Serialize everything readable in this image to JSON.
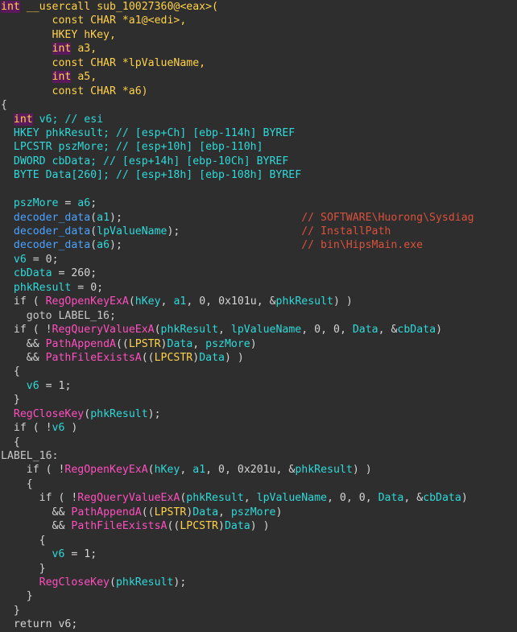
{
  "app": {
    "name": "ida-pseudocode-view",
    "theme": "dark"
  },
  "colors": {
    "background": "#2e2e2e",
    "default_text": "#d4d4d4",
    "keyword": "#ffd24a",
    "keyword_highlight_bg": "#5c1a5c",
    "api_function": "#ff4fbf",
    "user_function": "#4aa3ff",
    "variable": "#2fd9d9",
    "comment_local": "#2fd9d9",
    "comment_repeatable": "#d9513c",
    "number": "#d4d4d4",
    "label": "#c8c8c8"
  },
  "code": {
    "function_name": "sub_10027360",
    "lines": [
      [
        {
          "t": "int",
          "c": "t-kw-hl"
        },
        {
          "t": " ",
          "c": "t-plain"
        },
        {
          "t": "__usercall sub_10027360@<eax>(",
          "c": "t-fn"
        }
      ],
      [
        {
          "t": "        ",
          "c": "t-plain"
        },
        {
          "t": "const CHAR *a1@<edi>,",
          "c": "t-type"
        }
      ],
      [
        {
          "t": "        ",
          "c": "t-plain"
        },
        {
          "t": "HKEY hKey,",
          "c": "t-type"
        }
      ],
      [
        {
          "t": "        ",
          "c": "t-plain"
        },
        {
          "t": "int",
          "c": "t-kw-hl"
        },
        {
          "t": " ",
          "c": "t-plain"
        },
        {
          "t": "a3,",
          "c": "t-type"
        }
      ],
      [
        {
          "t": "        ",
          "c": "t-plain"
        },
        {
          "t": "const CHAR *lpValueName,",
          "c": "t-type"
        }
      ],
      [
        {
          "t": "        ",
          "c": "t-plain"
        },
        {
          "t": "int",
          "c": "t-kw-hl"
        },
        {
          "t": " ",
          "c": "t-plain"
        },
        {
          "t": "a5,",
          "c": "t-type"
        }
      ],
      [
        {
          "t": "        ",
          "c": "t-plain"
        },
        {
          "t": "const CHAR *a6)",
          "c": "t-type"
        }
      ],
      [
        {
          "t": "{",
          "c": "t-punct"
        }
      ],
      [
        {
          "t": "  ",
          "c": "t-plain"
        },
        {
          "t": "int",
          "c": "t-kw-hl"
        },
        {
          "t": " ",
          "c": "t-plain"
        },
        {
          "t": "v6;",
          "c": "t-var"
        },
        {
          "t": " ",
          "c": "t-plain"
        },
        {
          "t": "// esi",
          "c": "t-cmt"
        }
      ],
      [
        {
          "t": "  ",
          "c": "t-plain"
        },
        {
          "t": "HKEY phkResult;",
          "c": "t-var"
        },
        {
          "t": " ",
          "c": "t-plain"
        },
        {
          "t": "// [esp+Ch] [ebp-114h] BYREF",
          "c": "t-cmt"
        }
      ],
      [
        {
          "t": "  ",
          "c": "t-plain"
        },
        {
          "t": "LPCSTR pszMore;",
          "c": "t-var"
        },
        {
          "t": " ",
          "c": "t-plain"
        },
        {
          "t": "// [esp+10h] [ebp-110h]",
          "c": "t-cmt"
        }
      ],
      [
        {
          "t": "  ",
          "c": "t-plain"
        },
        {
          "t": "DWORD cbData;",
          "c": "t-var"
        },
        {
          "t": " ",
          "c": "t-plain"
        },
        {
          "t": "// [esp+14h] [ebp-10Ch] BYREF",
          "c": "t-cmt"
        }
      ],
      [
        {
          "t": "  ",
          "c": "t-plain"
        },
        {
          "t": "BYTE Data[260];",
          "c": "t-var"
        },
        {
          "t": " ",
          "c": "t-plain"
        },
        {
          "t": "// [esp+18h] [ebp-108h] BYREF",
          "c": "t-cmt"
        }
      ],
      [
        {
          "t": "",
          "c": "t-plain"
        }
      ],
      [
        {
          "t": "  ",
          "c": "t-plain"
        },
        {
          "t": "pszMore",
          "c": "t-var"
        },
        {
          "t": " = ",
          "c": "t-punct"
        },
        {
          "t": "a6",
          "c": "t-var"
        },
        {
          "t": ";",
          "c": "t-punct"
        }
      ],
      [
        {
          "t": "  ",
          "c": "t-plain"
        },
        {
          "t": "decoder_data",
          "c": "t-userfn"
        },
        {
          "t": "(",
          "c": "t-punct"
        },
        {
          "t": "a1",
          "c": "t-var"
        },
        {
          "t": ");",
          "c": "t-punct"
        },
        {
          "t": "                            ",
          "c": "t-plain"
        },
        {
          "t": "// SOFTWARE\\Huorong\\Sysdiag",
          "c": "t-cmt-rep"
        }
      ],
      [
        {
          "t": "  ",
          "c": "t-plain"
        },
        {
          "t": "decoder_data",
          "c": "t-userfn"
        },
        {
          "t": "(",
          "c": "t-punct"
        },
        {
          "t": "lpValueName",
          "c": "t-var"
        },
        {
          "t": ");",
          "c": "t-punct"
        },
        {
          "t": "                   ",
          "c": "t-plain"
        },
        {
          "t": "// InstallPath",
          "c": "t-cmt-rep"
        }
      ],
      [
        {
          "t": "  ",
          "c": "t-plain"
        },
        {
          "t": "decoder_data",
          "c": "t-userfn"
        },
        {
          "t": "(",
          "c": "t-punct"
        },
        {
          "t": "a6",
          "c": "t-var"
        },
        {
          "t": ");",
          "c": "t-punct"
        },
        {
          "t": "                            ",
          "c": "t-plain"
        },
        {
          "t": "// bin\\HipsMain.exe",
          "c": "t-cmt-rep"
        }
      ],
      [
        {
          "t": "  ",
          "c": "t-plain"
        },
        {
          "t": "v6",
          "c": "t-var"
        },
        {
          "t": " = ",
          "c": "t-punct"
        },
        {
          "t": "0",
          "c": "t-num"
        },
        {
          "t": ";",
          "c": "t-punct"
        }
      ],
      [
        {
          "t": "  ",
          "c": "t-plain"
        },
        {
          "t": "cbData",
          "c": "t-var"
        },
        {
          "t": " = ",
          "c": "t-punct"
        },
        {
          "t": "260",
          "c": "t-num"
        },
        {
          "t": ";",
          "c": "t-punct"
        }
      ],
      [
        {
          "t": "  ",
          "c": "t-plain"
        },
        {
          "t": "phkResult",
          "c": "t-var"
        },
        {
          "t": " = ",
          "c": "t-punct"
        },
        {
          "t": "0",
          "c": "t-num"
        },
        {
          "t": ";",
          "c": "t-punct"
        }
      ],
      [
        {
          "t": "  ",
          "c": "t-plain"
        },
        {
          "t": "if",
          "c": "t-plain"
        },
        {
          "t": " ( ",
          "c": "t-punct"
        },
        {
          "t": "RegOpenKeyExA",
          "c": "t-api"
        },
        {
          "t": "(",
          "c": "t-punct"
        },
        {
          "t": "hKey",
          "c": "t-var"
        },
        {
          "t": ", ",
          "c": "t-punct"
        },
        {
          "t": "a1",
          "c": "t-var"
        },
        {
          "t": ", ",
          "c": "t-punct"
        },
        {
          "t": "0",
          "c": "t-num"
        },
        {
          "t": ", ",
          "c": "t-punct"
        },
        {
          "t": "0x101u",
          "c": "t-num"
        },
        {
          "t": ", &",
          "c": "t-punct"
        },
        {
          "t": "phkResult",
          "c": "t-var"
        },
        {
          "t": ") )",
          "c": "t-punct"
        }
      ],
      [
        {
          "t": "    ",
          "c": "t-plain"
        },
        {
          "t": "goto LABEL_16;",
          "c": "t-label"
        }
      ],
      [
        {
          "t": "  ",
          "c": "t-plain"
        },
        {
          "t": "if",
          "c": "t-plain"
        },
        {
          "t": " ( !",
          "c": "t-punct"
        },
        {
          "t": "RegQueryValueExA",
          "c": "t-api"
        },
        {
          "t": "(",
          "c": "t-punct"
        },
        {
          "t": "phkResult",
          "c": "t-var"
        },
        {
          "t": ", ",
          "c": "t-punct"
        },
        {
          "t": "lpValueName",
          "c": "t-var"
        },
        {
          "t": ", ",
          "c": "t-punct"
        },
        {
          "t": "0",
          "c": "t-num"
        },
        {
          "t": ", ",
          "c": "t-punct"
        },
        {
          "t": "0",
          "c": "t-num"
        },
        {
          "t": ", ",
          "c": "t-punct"
        },
        {
          "t": "Data",
          "c": "t-var"
        },
        {
          "t": ", &",
          "c": "t-punct"
        },
        {
          "t": "cbData",
          "c": "t-var"
        },
        {
          "t": ")",
          "c": "t-punct"
        }
      ],
      [
        {
          "t": "    ",
          "c": "t-plain"
        },
        {
          "t": "&&",
          "c": "t-plain"
        },
        {
          "t": " ",
          "c": "t-punct"
        },
        {
          "t": "PathAppendA",
          "c": "t-api"
        },
        {
          "t": "((",
          "c": "t-punct"
        },
        {
          "t": "LPSTR",
          "c": "t-type"
        },
        {
          "t": ")",
          "c": "t-punct"
        },
        {
          "t": "Data",
          "c": "t-var"
        },
        {
          "t": ", ",
          "c": "t-punct"
        },
        {
          "t": "pszMore",
          "c": "t-var"
        },
        {
          "t": ")",
          "c": "t-punct"
        }
      ],
      [
        {
          "t": "    ",
          "c": "t-plain"
        },
        {
          "t": "&&",
          "c": "t-plain"
        },
        {
          "t": " ",
          "c": "t-punct"
        },
        {
          "t": "PathFileExistsA",
          "c": "t-api"
        },
        {
          "t": "((",
          "c": "t-punct"
        },
        {
          "t": "LPCSTR",
          "c": "t-type"
        },
        {
          "t": ")",
          "c": "t-punct"
        },
        {
          "t": "Data",
          "c": "t-var"
        },
        {
          "t": ") )",
          "c": "t-punct"
        }
      ],
      [
        {
          "t": "  ",
          "c": "t-plain"
        },
        {
          "t": "{",
          "c": "t-punct"
        }
      ],
      [
        {
          "t": "    ",
          "c": "t-plain"
        },
        {
          "t": "v6",
          "c": "t-var"
        },
        {
          "t": " = ",
          "c": "t-punct"
        },
        {
          "t": "1",
          "c": "t-num"
        },
        {
          "t": ";",
          "c": "t-punct"
        }
      ],
      [
        {
          "t": "  ",
          "c": "t-plain"
        },
        {
          "t": "}",
          "c": "t-punct"
        }
      ],
      [
        {
          "t": "  ",
          "c": "t-plain"
        },
        {
          "t": "RegCloseKey",
          "c": "t-api"
        },
        {
          "t": "(",
          "c": "t-punct"
        },
        {
          "t": "phkResult",
          "c": "t-var"
        },
        {
          "t": ");",
          "c": "t-punct"
        }
      ],
      [
        {
          "t": "  ",
          "c": "t-plain"
        },
        {
          "t": "if",
          "c": "t-plain"
        },
        {
          "t": " ( !",
          "c": "t-punct"
        },
        {
          "t": "v6",
          "c": "t-var"
        },
        {
          "t": " )",
          "c": "t-punct"
        }
      ],
      [
        {
          "t": "  ",
          "c": "t-plain"
        },
        {
          "t": "{",
          "c": "t-punct"
        }
      ],
      [
        {
          "t": "LABEL_16:",
          "c": "t-label"
        }
      ],
      [
        {
          "t": "    ",
          "c": "t-plain"
        },
        {
          "t": "if",
          "c": "t-plain"
        },
        {
          "t": " ( !",
          "c": "t-punct"
        },
        {
          "t": "RegOpenKeyExA",
          "c": "t-api"
        },
        {
          "t": "(",
          "c": "t-punct"
        },
        {
          "t": "hKey",
          "c": "t-var"
        },
        {
          "t": ", ",
          "c": "t-punct"
        },
        {
          "t": "a1",
          "c": "t-var"
        },
        {
          "t": ", ",
          "c": "t-punct"
        },
        {
          "t": "0",
          "c": "t-num"
        },
        {
          "t": ", ",
          "c": "t-punct"
        },
        {
          "t": "0x201u",
          "c": "t-num"
        },
        {
          "t": ", &",
          "c": "t-punct"
        },
        {
          "t": "phkResult",
          "c": "t-var"
        },
        {
          "t": ") )",
          "c": "t-punct"
        }
      ],
      [
        {
          "t": "    ",
          "c": "t-plain"
        },
        {
          "t": "{",
          "c": "t-punct"
        }
      ],
      [
        {
          "t": "      ",
          "c": "t-plain"
        },
        {
          "t": "if",
          "c": "t-plain"
        },
        {
          "t": " ( !",
          "c": "t-punct"
        },
        {
          "t": "RegQueryValueExA",
          "c": "t-api"
        },
        {
          "t": "(",
          "c": "t-punct"
        },
        {
          "t": "phkResult",
          "c": "t-var"
        },
        {
          "t": ", ",
          "c": "t-punct"
        },
        {
          "t": "lpValueName",
          "c": "t-var"
        },
        {
          "t": ", ",
          "c": "t-punct"
        },
        {
          "t": "0",
          "c": "t-num"
        },
        {
          "t": ", ",
          "c": "t-punct"
        },
        {
          "t": "0",
          "c": "t-num"
        },
        {
          "t": ", ",
          "c": "t-punct"
        },
        {
          "t": "Data",
          "c": "t-var"
        },
        {
          "t": ", &",
          "c": "t-punct"
        },
        {
          "t": "cbData",
          "c": "t-var"
        },
        {
          "t": ")",
          "c": "t-punct"
        }
      ],
      [
        {
          "t": "        ",
          "c": "t-plain"
        },
        {
          "t": "&&",
          "c": "t-plain"
        },
        {
          "t": " ",
          "c": "t-punct"
        },
        {
          "t": "PathAppendA",
          "c": "t-api"
        },
        {
          "t": "((",
          "c": "t-punct"
        },
        {
          "t": "LPSTR",
          "c": "t-type"
        },
        {
          "t": ")",
          "c": "t-punct"
        },
        {
          "t": "Data",
          "c": "t-var"
        },
        {
          "t": ", ",
          "c": "t-punct"
        },
        {
          "t": "pszMore",
          "c": "t-var"
        },
        {
          "t": ")",
          "c": "t-punct"
        }
      ],
      [
        {
          "t": "        ",
          "c": "t-plain"
        },
        {
          "t": "&&",
          "c": "t-plain"
        },
        {
          "t": " ",
          "c": "t-punct"
        },
        {
          "t": "PathFileExistsA",
          "c": "t-api"
        },
        {
          "t": "((",
          "c": "t-punct"
        },
        {
          "t": "LPCSTR",
          "c": "t-type"
        },
        {
          "t": ")",
          "c": "t-punct"
        },
        {
          "t": "Data",
          "c": "t-var"
        },
        {
          "t": ") )",
          "c": "t-punct"
        }
      ],
      [
        {
          "t": "      ",
          "c": "t-plain"
        },
        {
          "t": "{",
          "c": "t-punct"
        }
      ],
      [
        {
          "t": "        ",
          "c": "t-plain"
        },
        {
          "t": "v6",
          "c": "t-var"
        },
        {
          "t": " = ",
          "c": "t-punct"
        },
        {
          "t": "1",
          "c": "t-num"
        },
        {
          "t": ";",
          "c": "t-punct"
        }
      ],
      [
        {
          "t": "      ",
          "c": "t-plain"
        },
        {
          "t": "}",
          "c": "t-punct"
        }
      ],
      [
        {
          "t": "      ",
          "c": "t-plain"
        },
        {
          "t": "RegCloseKey",
          "c": "t-api"
        },
        {
          "t": "(",
          "c": "t-punct"
        },
        {
          "t": "phkResult",
          "c": "t-var"
        },
        {
          "t": ");",
          "c": "t-punct"
        }
      ],
      [
        {
          "t": "    ",
          "c": "t-plain"
        },
        {
          "t": "}",
          "c": "t-punct"
        }
      ],
      [
        {
          "t": "  ",
          "c": "t-plain"
        },
        {
          "t": "}",
          "c": "t-punct"
        }
      ],
      [
        {
          "t": "  ",
          "c": "t-plain"
        },
        {
          "t": "return v6;",
          "c": "t-plain"
        }
      ]
    ]
  }
}
